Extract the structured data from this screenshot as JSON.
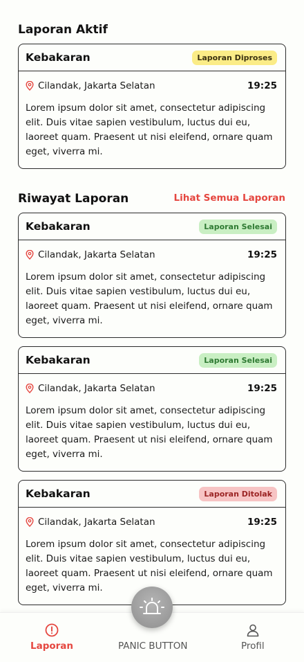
{
  "active": {
    "title": "Laporan Aktif",
    "card": {
      "title": "Kebakaran",
      "status": "Laporan Diproses",
      "location": "Cilandak, Jakarta Selatan",
      "time": "19:25",
      "body": "Lorem ipsum dolor sit amet, consectetur adipiscing elit. Duis vitae sapien vestibulum, luctus dui eu, laoreet quam. Praesent ut nisi eleifend, ornare quam eget, viverra mi."
    }
  },
  "history": {
    "title": "Riwayat Laporan",
    "see_all": "Lihat Semua Laporan",
    "cards": [
      {
        "title": "Kebakaran",
        "status": "Laporan Selesai",
        "location": "Cilandak, Jakarta Selatan",
        "time": "19:25",
        "body": "Lorem ipsum dolor sit amet, consectetur adipiscing elit. Duis vitae sapien vestibulum, luctus dui eu, laoreet quam. Praesent ut nisi eleifend, ornare quam eget, viverra mi."
      },
      {
        "title": "Kebakaran",
        "status": "Laporan Selesai",
        "location": "Cilandak, Jakarta Selatan",
        "time": "19:25",
        "body": "Lorem ipsum dolor sit amet, consectetur adipiscing elit. Duis vitae sapien vestibulum, luctus dui eu, laoreet quam. Praesent ut nisi eleifend, ornare quam eget, viverra mi."
      },
      {
        "title": "Kebakaran",
        "status": "Laporan Ditolak",
        "location": "Cilandak, Jakarta Selatan",
        "time": "19:25",
        "body": "Lorem ipsum dolor sit amet, consectetur adipiscing elit. Duis vitae sapien vestibulum, luctus dui eu, laoreet quam. Praesent ut nisi eleifend, ornare quam eget, viverra mi."
      }
    ]
  },
  "nav": {
    "laporan": "Laporan",
    "panic": "PANIC BUTTON",
    "profil": "Profil"
  },
  "colors": {
    "accent": "#e5463f",
    "status_proses": "#fbec87",
    "status_selesai": "#c9efc3",
    "status_ditolak": "#f7c4c4"
  }
}
